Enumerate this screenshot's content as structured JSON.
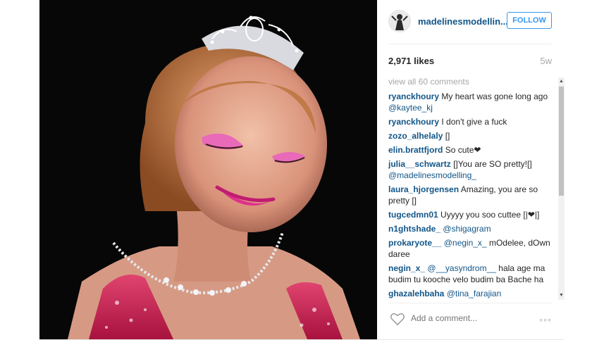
{
  "post": {
    "username": "madelinesmodellin...",
    "follow_label": "FOLLOW",
    "likes": "2,971 likes",
    "age": "5w",
    "view_all": "view all 60 comments",
    "add_comment_placeholder": "Add a comment...",
    "more_label": "◦◦◦"
  },
  "comments": [
    {
      "user": "ryanckhoury",
      "text": "My heart was gone long ago ",
      "mention": "@kaytee_kj"
    },
    {
      "user": "ryanckhoury",
      "text": "I don't give a fuck",
      "mention": ""
    },
    {
      "user": "zozo_alhelaly",
      "text": "[]",
      "mention": ""
    },
    {
      "user": "elin.brattfjord",
      "text": "So cute❤",
      "mention": ""
    },
    {
      "user": "julia__schwartz",
      "text": "[]You are SO pretty![] ",
      "mention": "@madelinesmodelling_"
    },
    {
      "user": "laura_hjorgensen",
      "text": "Amazing, you are so pretty []",
      "mention": ""
    },
    {
      "user": "tugcedmn01",
      "text": "Uyyyy you soo cuttee [|❤|]",
      "mention": ""
    },
    {
      "user": "n1ghtshade_",
      "text": "",
      "mention": "@shigagram"
    },
    {
      "user": "prokaryote__",
      "text": "mOdelee, dOwn daree",
      "mention": "@negin_x_"
    },
    {
      "user": "negin_x_",
      "text": "hala age ma budim tu kooche velo budim ba Bache ha",
      "mention": "@__yasyndrom__"
    },
    {
      "user": "ghazalehbaha",
      "text": "",
      "mention": "@tina_farajian"
    }
  ],
  "scrollbar": {
    "up": "▲",
    "down": "▼"
  },
  "icons": {
    "like": "heart-icon",
    "more": "more-options-icon"
  },
  "colors": {
    "username": "#125688",
    "follow": "#3897f0",
    "muted": "#a5a7aa"
  }
}
